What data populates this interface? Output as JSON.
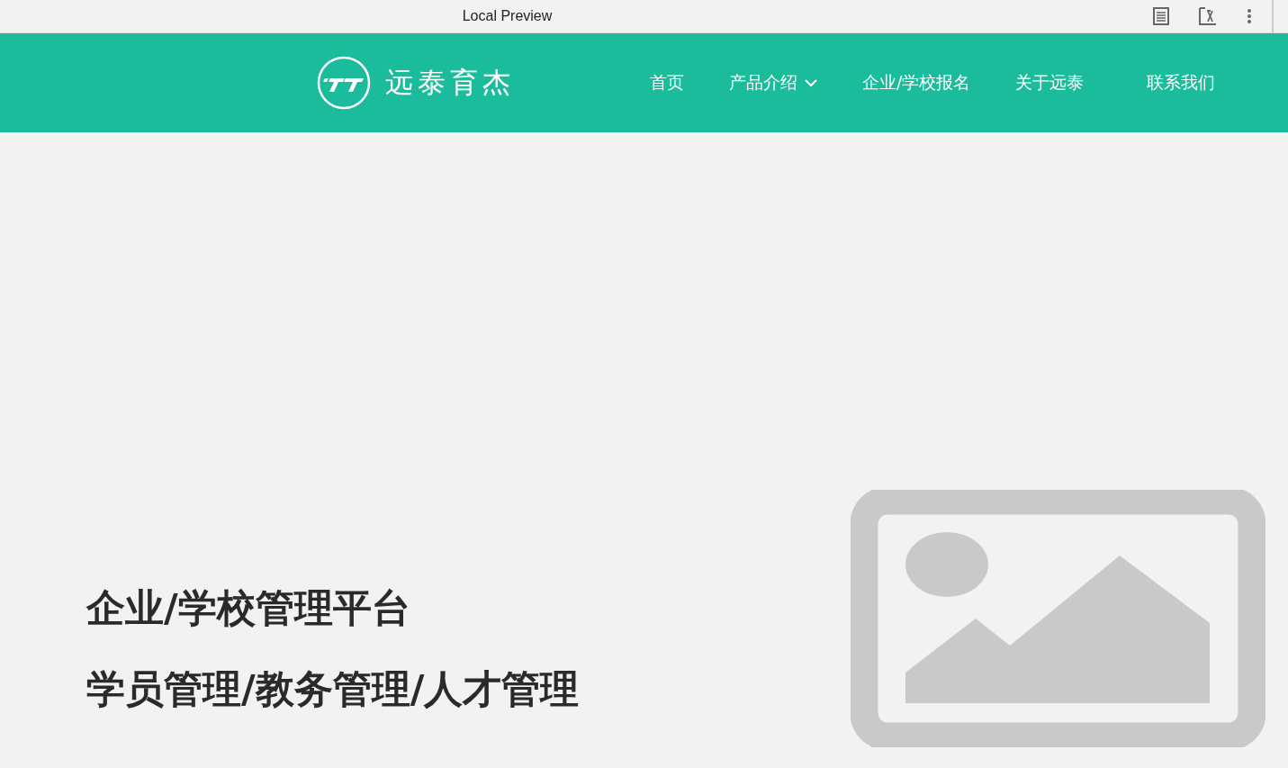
{
  "preview_bar": {
    "title": "Local Preview"
  },
  "header": {
    "brand": "远泰育杰",
    "nav": [
      {
        "label": "首页",
        "dropdown": false
      },
      {
        "label": "产品介绍",
        "dropdown": true
      },
      {
        "label": "企业/学校报名",
        "dropdown": false
      },
      {
        "label": "关于远泰",
        "dropdown": false
      },
      {
        "label": "联系我们",
        "dropdown": false
      }
    ]
  },
  "hero": {
    "headings": [
      "企业/学校管理平台",
      "学员管理/教务管理/人才管理"
    ]
  }
}
